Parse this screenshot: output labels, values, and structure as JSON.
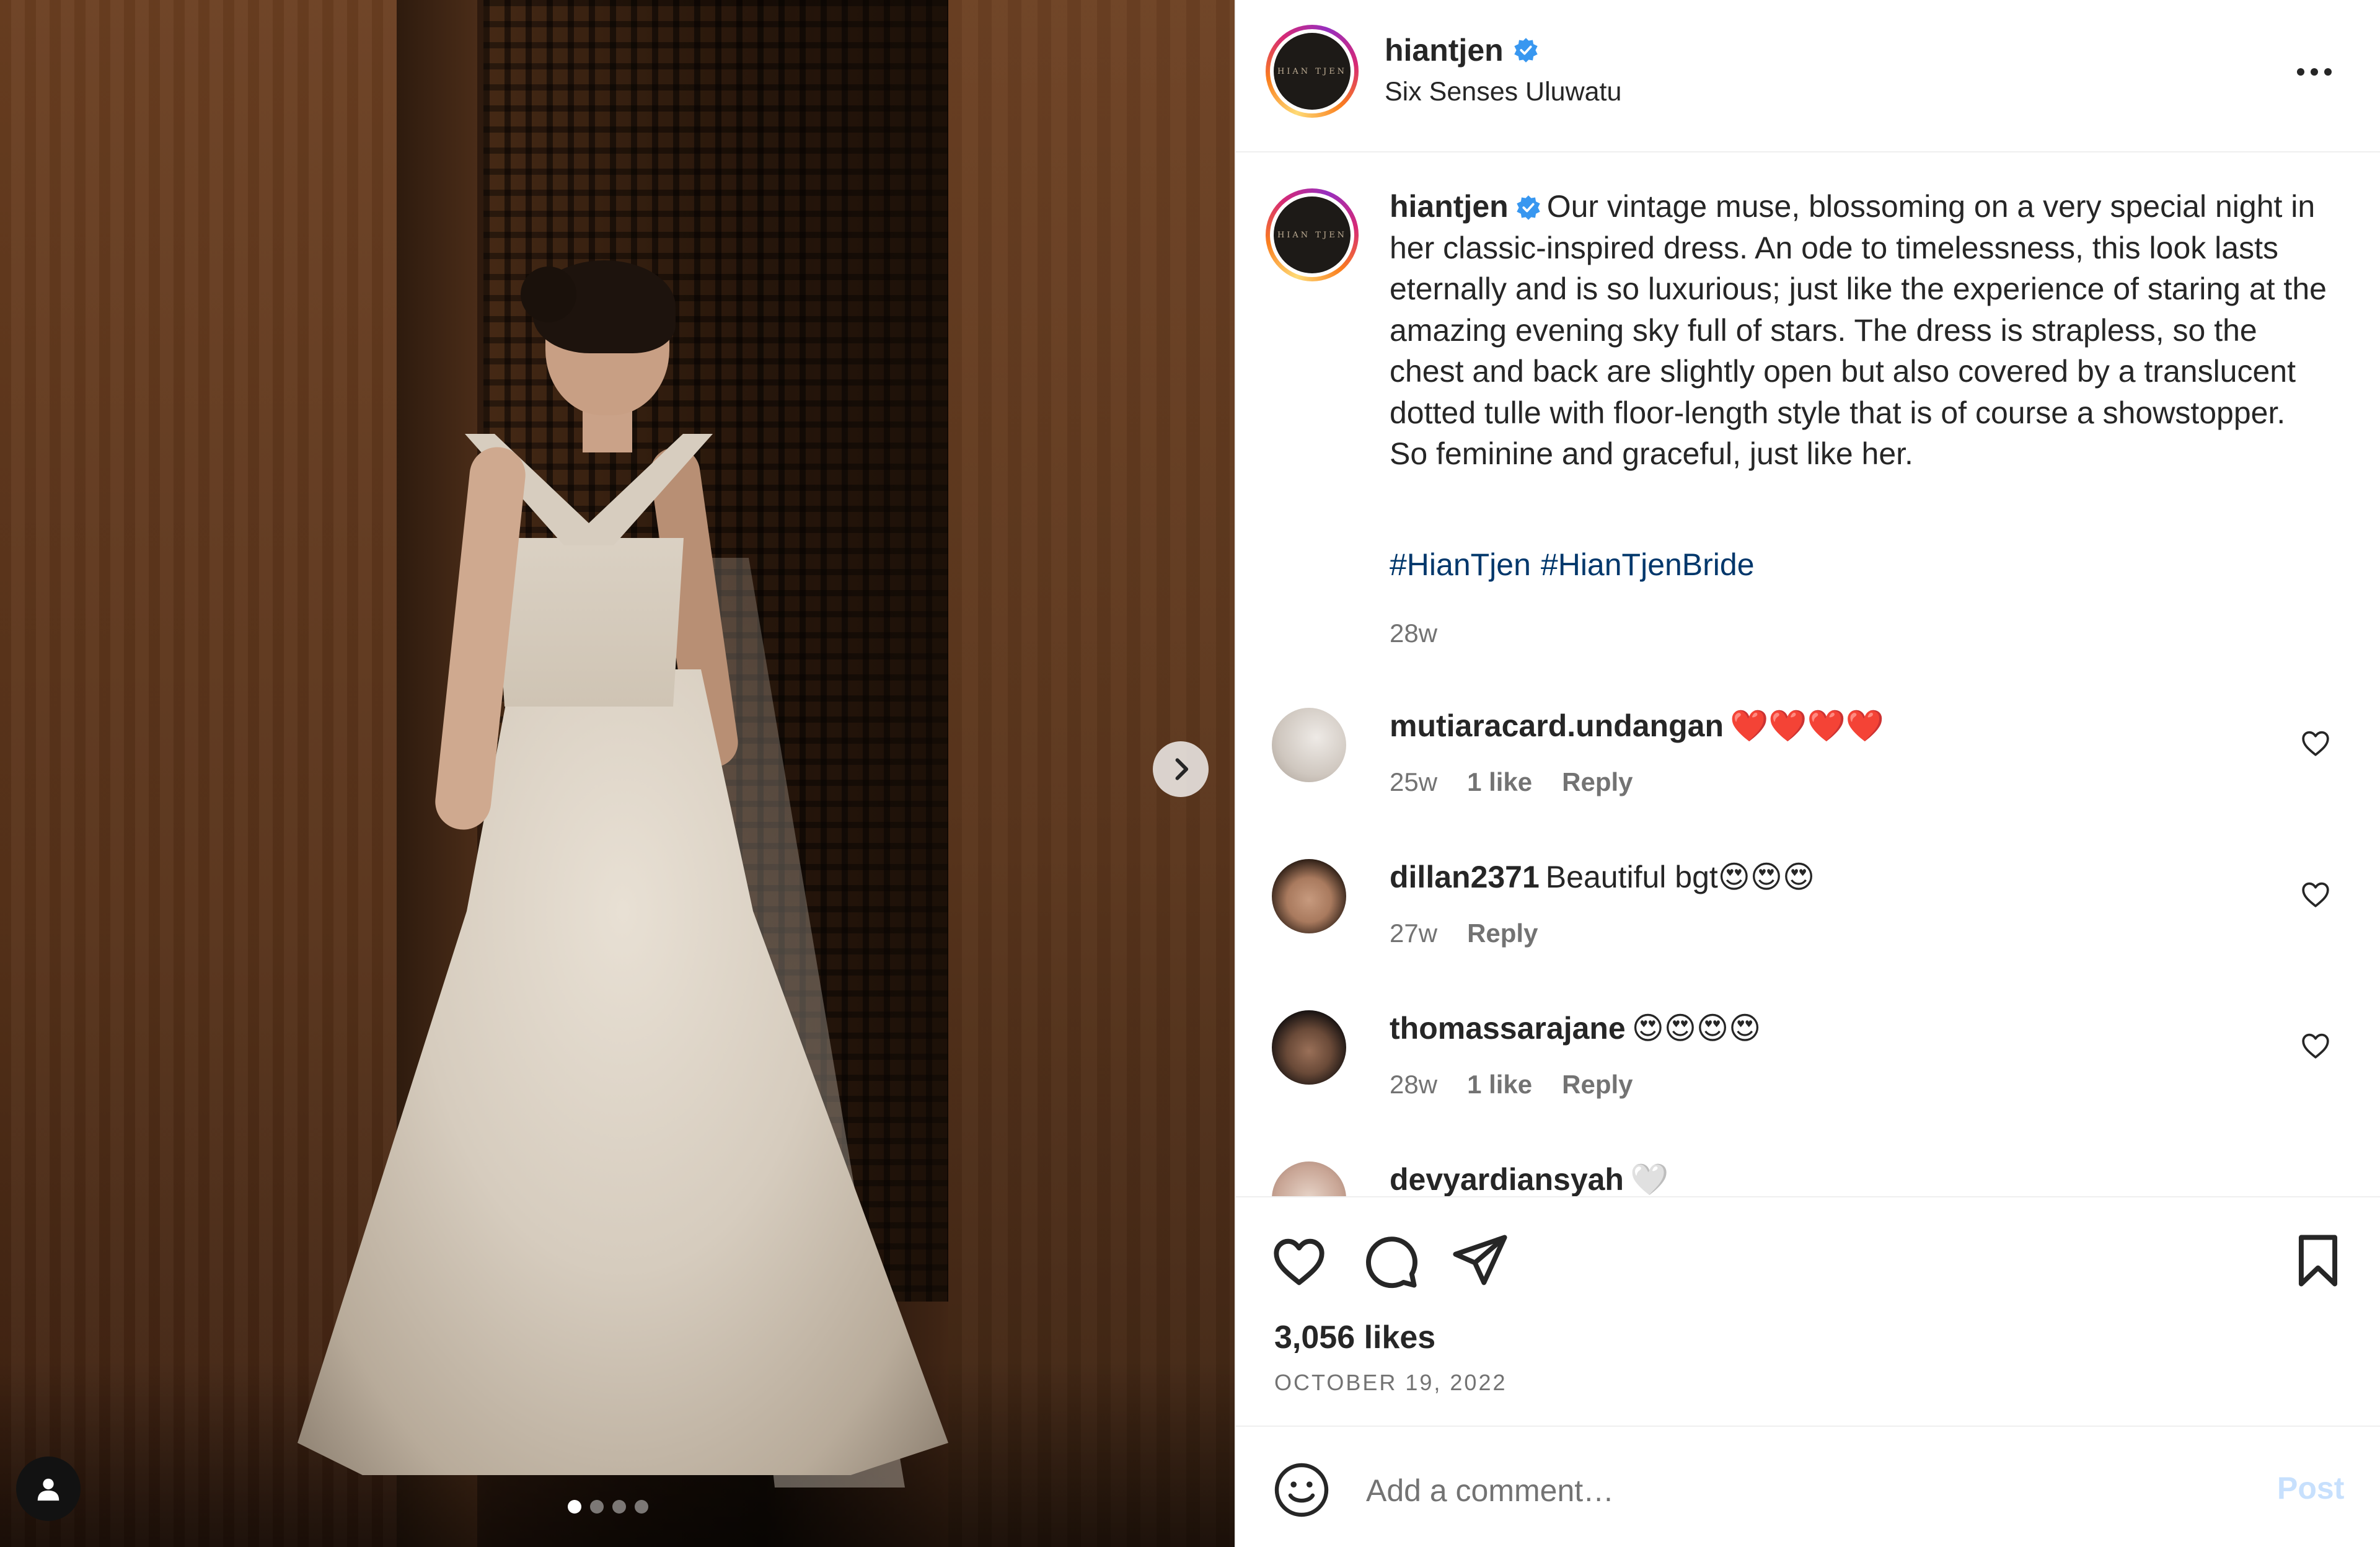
{
  "post": {
    "username": "hiantjen",
    "location": "Six Senses Uluwatu",
    "avatar_text": "HIAN TJEN",
    "verified": true
  },
  "caption": {
    "username": "hiantjen",
    "text": "Our vintage muse, blossoming on a very special night in her classic-inspired dress. An ode to timelessness, this look lasts eternally and is so luxurious; just like the experience of staring at the amazing evening sky full of stars. The dress is strapless, so the chest and back are slightly open but also covered by a translucent dotted tulle with floor-length style that is of course a showstopper. So feminine and graceful, just like her.",
    "hashtags": [
      "#HianTjen",
      "#HianTjenBride"
    ],
    "age": "28w"
  },
  "comments": [
    {
      "username": "mutiaracard.undangan",
      "text": "❤️❤️❤️❤️",
      "age": "25w",
      "likes": "1 like",
      "reply": "Reply"
    },
    {
      "username": "dillan2371",
      "text": "Beautiful bgt😍😍😍",
      "age": "27w",
      "likes": "",
      "reply": "Reply"
    },
    {
      "username": "thomassarajane",
      "text": "😍😍😍😍",
      "age": "28w",
      "likes": "1 like",
      "reply": "Reply"
    },
    {
      "username": "devyardiansyah",
      "text": "🤍",
      "age": "",
      "likes": "",
      "reply": ""
    }
  ],
  "stats": {
    "likes": "3,056 likes",
    "date": "OCTOBER 19, 2022"
  },
  "composer": {
    "placeholder": "Add a comment…",
    "post_label": "Post"
  },
  "carousel": {
    "count": 4,
    "active_index": 0
  },
  "colors": {
    "verified": "#3897f0",
    "hashtag": "#00376b",
    "muted": "#737373",
    "post_disabled": "#c7e0fd"
  },
  "icons": {
    "more": "more-horizontal-icon",
    "like": "heart-icon",
    "comment": "comment-bubble-icon",
    "share": "paper-plane-icon",
    "save": "bookmark-icon",
    "emoji": "smile-icon",
    "next": "chevron-right-icon",
    "tag": "user-tag-icon"
  }
}
